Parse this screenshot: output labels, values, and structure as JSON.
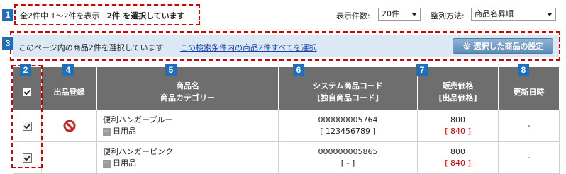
{
  "summary": {
    "range_text": "全2件中 1〜2件を表示",
    "selected_text": "2件 を選択しています"
  },
  "controls": {
    "display_count_label": "表示件数:",
    "display_count_value": "20件",
    "sort_label": "整列方法:",
    "sort_value": "商品名昇順"
  },
  "info_bar": {
    "text": "このページ内の商品2件を選択しています",
    "link": "この検索条件内の商品2件すべてを選択",
    "button_label": "選択した商品の設定"
  },
  "callouts": [
    "1",
    "2",
    "3",
    "4",
    "5",
    "6",
    "7",
    "8"
  ],
  "table": {
    "headers": {
      "listing": "出品登録",
      "name_line1": "商品名",
      "name_line2": "商品カテゴリー",
      "code_line1": "システム商品コード",
      "code_line2": "[独自商品コード]",
      "price_line1": "販売価格",
      "price_line2": "[出品価格]",
      "updated": "更新日時"
    },
    "rows": [
      {
        "checked": true,
        "listing_icon": "prohibited-icon",
        "name": "便利ハンガーブルー",
        "category": "日用品",
        "system_code": "000000005764",
        "custom_code": "[ 123456789 ]",
        "price": "800",
        "list_price": "[ 840 ]",
        "updated": "-"
      },
      {
        "checked": true,
        "listing_icon": "",
        "name": "便利ハンガーピンク",
        "category": "日用品",
        "system_code": "000000005865",
        "custom_code": "[ - ]",
        "price": "800",
        "list_price": "[ 840 ]",
        "updated": "-"
      }
    ]
  },
  "colors": {
    "callout": "#1d6fbd",
    "highlight_border": "#d40000",
    "header_bg": "#6e6e6e",
    "info_bar_bg": "#dde8f5",
    "price_red": "#c00000",
    "link": "#1a3fa8"
  }
}
